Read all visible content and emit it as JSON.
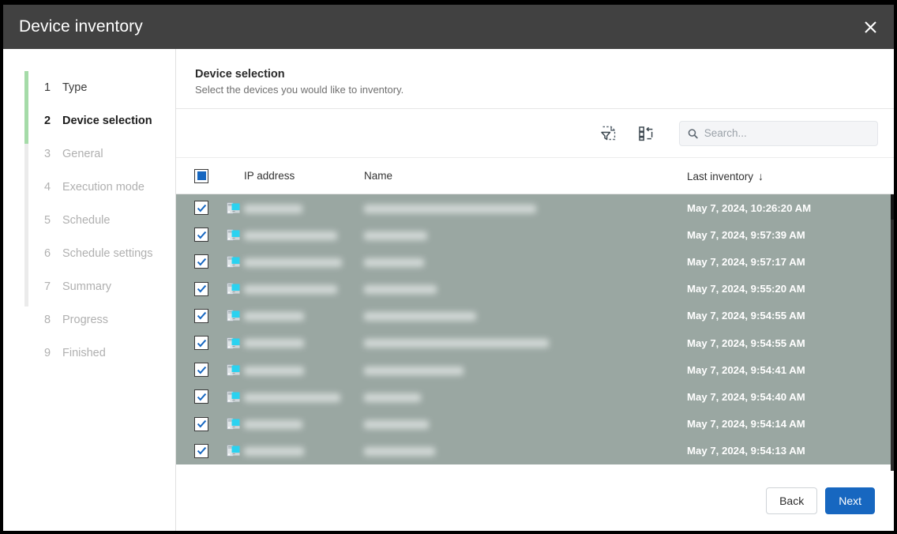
{
  "window": {
    "title": "Device inventory",
    "close_label": "×"
  },
  "sidebar": {
    "steps": [
      {
        "num": "1",
        "label": "Type",
        "state": "done"
      },
      {
        "num": "2",
        "label": "Device selection",
        "state": "current"
      },
      {
        "num": "3",
        "label": "General",
        "state": "todo"
      },
      {
        "num": "4",
        "label": "Execution mode",
        "state": "todo"
      },
      {
        "num": "5",
        "label": "Schedule",
        "state": "todo"
      },
      {
        "num": "6",
        "label": "Schedule settings",
        "state": "todo"
      },
      {
        "num": "7",
        "label": "Summary",
        "state": "todo"
      },
      {
        "num": "8",
        "label": "Progress",
        "state": "todo"
      },
      {
        "num": "9",
        "label": "Finished",
        "state": "todo"
      }
    ],
    "progress_color": "#a5dba8"
  },
  "page": {
    "heading": "Device selection",
    "subtitle": "Select the devices you would like to inventory."
  },
  "toolbar": {
    "filter_icon": "filter-document-icon",
    "columns_icon": "selection-list-icon",
    "search": {
      "placeholder": "Search...",
      "value": "",
      "icon": "search-icon"
    }
  },
  "table": {
    "select_all_state": "indeterminate",
    "columns": {
      "ip": "IP address",
      "name": "Name",
      "last_inventory": "Last inventory",
      "sort_arrow": "↓"
    },
    "sort": {
      "column": "Last inventory",
      "direction": "descending"
    },
    "rows": [
      {
        "checked": true,
        "icon": "computer-icon",
        "ip": "",
        "name": "",
        "last_inventory": "May 7, 2024, 10:26:20 AM",
        "ip_w": 74,
        "name_w": 218
      },
      {
        "checked": true,
        "icon": "computer-icon",
        "ip": "",
        "name": "",
        "last_inventory": "May 7, 2024, 9:57:39 AM",
        "ip_w": 118,
        "name_w": 80
      },
      {
        "checked": true,
        "icon": "computer-icon",
        "ip": "",
        "name": "",
        "last_inventory": "May 7, 2024, 9:57:17 AM",
        "ip_w": 124,
        "name_w": 76
      },
      {
        "checked": true,
        "icon": "computer-icon",
        "ip": "",
        "name": "",
        "last_inventory": "May 7, 2024, 9:55:20 AM",
        "ip_w": 118,
        "name_w": 92
      },
      {
        "checked": true,
        "icon": "computer-icon",
        "ip": "",
        "name": "",
        "last_inventory": "May 7, 2024, 9:54:55 AM",
        "ip_w": 76,
        "name_w": 142
      },
      {
        "checked": true,
        "icon": "computer-icon",
        "ip": "",
        "name": "",
        "last_inventory": "May 7, 2024, 9:54:55 AM",
        "ip_w": 76,
        "name_w": 234
      },
      {
        "checked": true,
        "icon": "computer-icon",
        "ip": "",
        "name": "",
        "last_inventory": "May 7, 2024, 9:54:41 AM",
        "ip_w": 76,
        "name_w": 126
      },
      {
        "checked": true,
        "icon": "computer-icon",
        "ip": "",
        "name": "",
        "last_inventory": "May 7, 2024, 9:54:40 AM",
        "ip_w": 122,
        "name_w": 72
      },
      {
        "checked": true,
        "icon": "computer-icon",
        "ip": "",
        "name": "",
        "last_inventory": "May 7, 2024, 9:54:14 AM",
        "ip_w": 74,
        "name_w": 82
      },
      {
        "checked": true,
        "icon": "computer-icon",
        "ip": "",
        "name": "",
        "last_inventory": "May 7, 2024, 9:54:13 AM",
        "ip_w": 76,
        "name_w": 90
      }
    ]
  },
  "footer": {
    "back_label": "Back",
    "next_label": "Next",
    "primary_color": "#1767c0"
  }
}
